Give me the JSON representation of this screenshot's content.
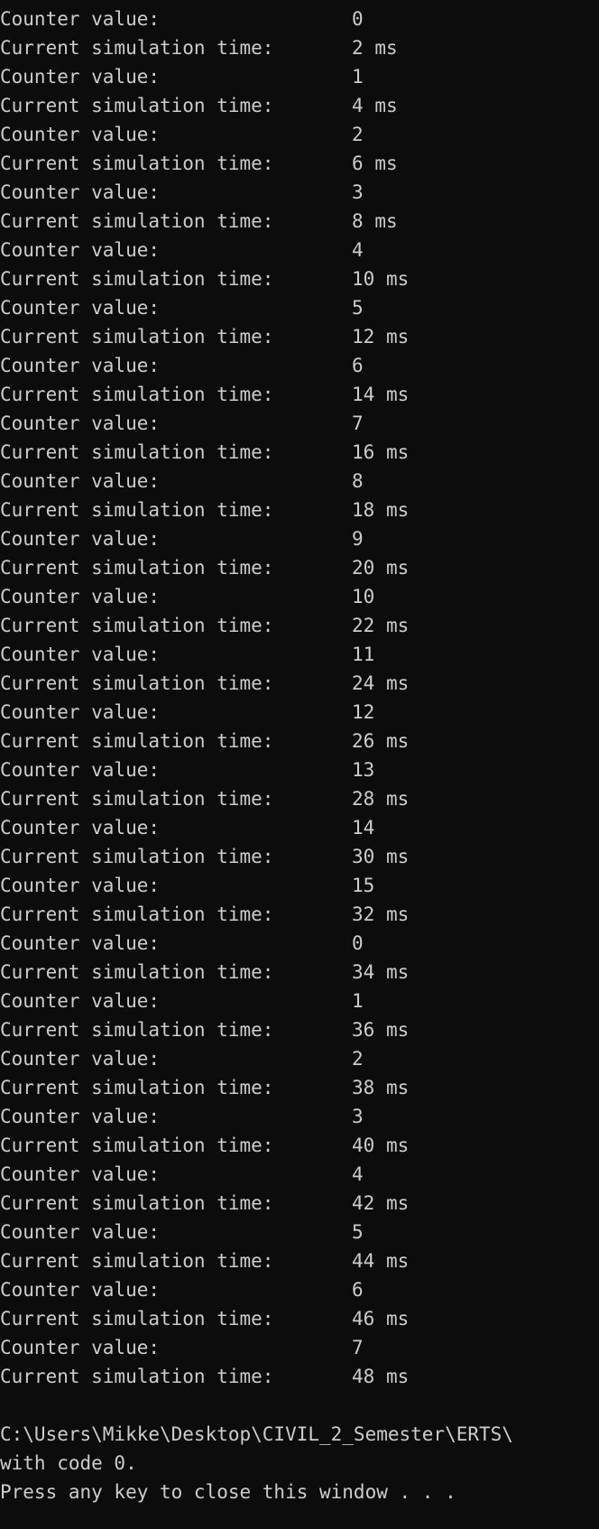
{
  "console": {
    "counter_label": "Counter value:",
    "time_label": "Current simulation time:",
    "time_unit": "ms",
    "entries": [
      {
        "counter": "0",
        "time": "2"
      },
      {
        "counter": "1",
        "time": "4"
      },
      {
        "counter": "2",
        "time": "6"
      },
      {
        "counter": "3",
        "time": "8"
      },
      {
        "counter": "4",
        "time": "10"
      },
      {
        "counter": "5",
        "time": "12"
      },
      {
        "counter": "6",
        "time": "14"
      },
      {
        "counter": "7",
        "time": "16"
      },
      {
        "counter": "8",
        "time": "18"
      },
      {
        "counter": "9",
        "time": "20"
      },
      {
        "counter": "10",
        "time": "22"
      },
      {
        "counter": "11",
        "time": "24"
      },
      {
        "counter": "12",
        "time": "26"
      },
      {
        "counter": "13",
        "time": "28"
      },
      {
        "counter": "14",
        "time": "30"
      },
      {
        "counter": "15",
        "time": "32"
      },
      {
        "counter": "0",
        "time": "34"
      },
      {
        "counter": "1",
        "time": "36"
      },
      {
        "counter": "2",
        "time": "38"
      },
      {
        "counter": "3",
        "time": "40"
      },
      {
        "counter": "4",
        "time": "42"
      },
      {
        "counter": "5",
        "time": "44"
      },
      {
        "counter": "6",
        "time": "46"
      },
      {
        "counter": "7",
        "time": "48"
      }
    ],
    "exit_path_line": "C:\\Users\\Mikke\\Desktop\\CIVIL_2_Semester\\ERTS\\",
    "exit_code_line": "with code 0.",
    "press_key_line": "Press any key to close this window . . ."
  },
  "colors": {
    "background": "#0c0c0c",
    "text": "#cccccc"
  }
}
